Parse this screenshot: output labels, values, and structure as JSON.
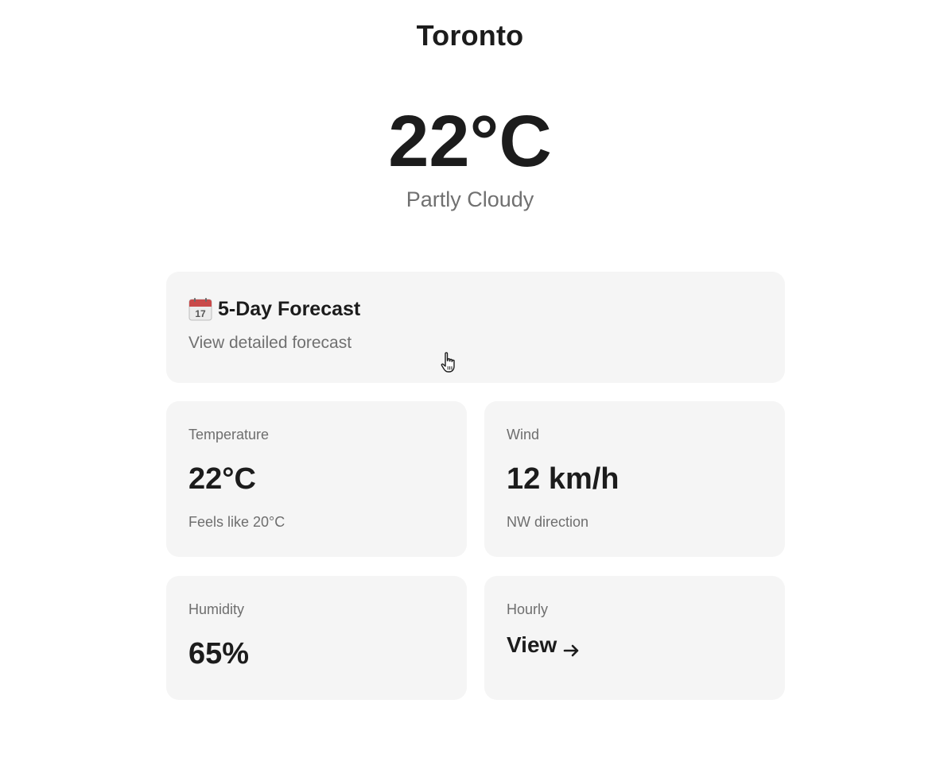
{
  "location": {
    "city": "Toronto"
  },
  "current": {
    "temperature": "22°C",
    "condition": "Partly Cloudy"
  },
  "forecast_card": {
    "icon": "calendar-icon",
    "icon_day": "17",
    "title": "5-Day Forecast",
    "subtitle": "View detailed forecast"
  },
  "stats": {
    "temperature": {
      "label": "Temperature",
      "value": "22°C",
      "sub": "Feels like 20°C"
    },
    "wind": {
      "label": "Wind",
      "value": "12 km/h",
      "sub": "NW direction"
    },
    "humidity": {
      "label": "Humidity",
      "value": "65%"
    },
    "hourly": {
      "label": "Hourly",
      "link_label": "View",
      "icon": "arrow-right-icon"
    }
  },
  "colors": {
    "card_background": "#f5f5f5",
    "primary_text": "#1c1c1c",
    "secondary_text": "#707070",
    "calendar_red": "#c94a4a"
  }
}
